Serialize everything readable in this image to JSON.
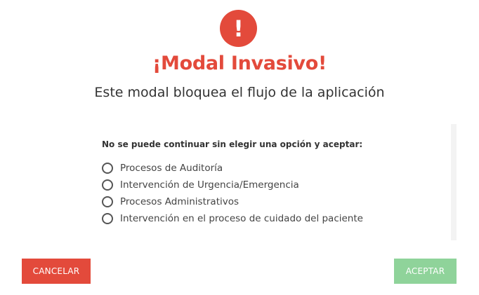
{
  "modal": {
    "icon_glyph": "!",
    "icon_name": "exclamation-icon",
    "title": "¡Modal Invasivo!",
    "subtitle": "Este modal bloquea el flujo de la aplicación",
    "question": "No se puede continuar sin elegir una opción y aceptar:",
    "options": [
      {
        "label": "Procesos de Auditoría",
        "selected": false
      },
      {
        "label": "Intervención de Urgencia/Emergencia",
        "selected": false
      },
      {
        "label": "Procesos Administrativos",
        "selected": false
      },
      {
        "label": "Intervención en el proceso de cuidado del paciente",
        "selected": false
      }
    ],
    "cancel_label": "CANCELAR",
    "accept_label": "ACEPTAR",
    "accept_enabled": false
  },
  "colors": {
    "danger": "#e34a3b",
    "accept_disabled": "#8fd39a",
    "text_dark": "#333333"
  }
}
